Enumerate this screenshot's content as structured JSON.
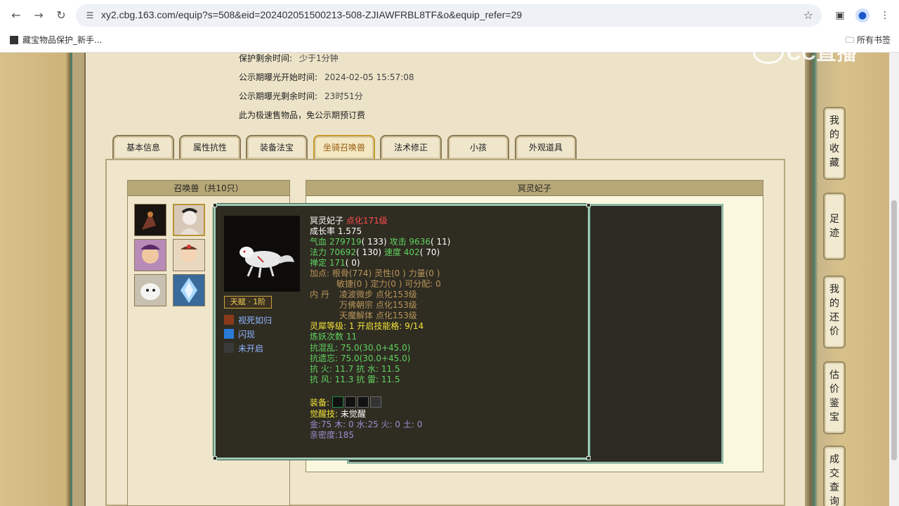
{
  "browser": {
    "url": "xy2.cbg.163.com/equip?s=508&eid=202402051500213-508-ZJIAWFRBL8TF&o&equip_refer=29",
    "bookmark": "藏宝物品保护_新手...",
    "all_bookmarks": "所有书签",
    "watermark": "CC直播"
  },
  "info": {
    "protect_label": "保护剩余时间:",
    "protect_value": "少于1分钟",
    "publicity_start_label": "公示期曝光开始时间:",
    "publicity_start_value": "2024-02-05 15:57:08",
    "publicity_left_label": "公示期曝光剩余时间:",
    "publicity_left_value": "23时51分",
    "fast_sale_note": "此为极速售物品，免公示期预订费"
  },
  "tabs": [
    "基本信息",
    "属性抗性",
    "装备法宝",
    "坐骑召唤兽",
    "法术修正",
    "小孩",
    "外观道具"
  ],
  "active_tab": "坐骑召唤兽",
  "summon_list": {
    "title": "召唤兽（共10只）"
  },
  "detail": {
    "title": "冥灵妃子"
  },
  "tooltip": {
    "name": "冥灵妃子",
    "rank": "点化171级",
    "growth": "成长率 1.575",
    "hp_label": "气血",
    "hp": "279719",
    "hp_pts": "( 133)",
    "atk_label": "攻击",
    "atk": "9636",
    "atk_pts": "( 11)",
    "mp_label": "法力",
    "mp": "70692",
    "mp_pts": "( 130)",
    "spd_label": "速度",
    "spd": "402",
    "spd_pts": "( 70)",
    "ding_label": "禅定",
    "ding": "171",
    "ding_pts": "( 0)",
    "points1": "加点:  根骨(774) 灵性(0 ) 力量(0 )",
    "points2": "敏捷(0 ) 定力(0 ) 可分配:   0",
    "dan_label": "内    丹",
    "dan1": "凌波微步 点化153级",
    "dan2": "万佛朝宗 点化153级",
    "dan3": "天魔解体 点化153级",
    "lingxi_label": "灵犀等级:",
    "lingxi": "1 开启技能格:  9/14",
    "refine": "炼妖次数 11",
    "resist1": "抗混乱: 75.0(30.0+45.0)",
    "resist2": "抗遗忘: 75.0(30.0+45.0)",
    "resist3": "抗    火: 11.7 抗    水: 11.5",
    "resist4": "抗    风: 11.3 抗    雷: 11.5",
    "equip_label": "装备:",
    "awaken_label": "觉醒技:",
    "awaken_value": "未觉醒",
    "elements": "金:75 木: 0 水:25 火: 0 土: 0",
    "intimacy": "亲密度:185",
    "talent": "天赋 · 1阶",
    "skills": [
      "视死如归",
      "闪现",
      "未开启"
    ]
  },
  "right_nav": [
    "我的收藏",
    "足迹",
    "我的还价",
    "估价鉴宝",
    "成交查询"
  ]
}
